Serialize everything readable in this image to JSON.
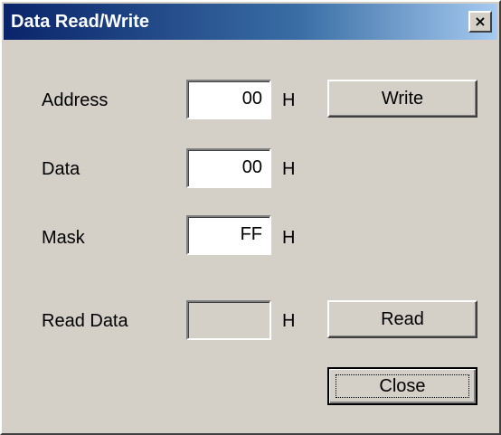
{
  "window": {
    "title": "Data Read/Write",
    "close_glyph": "×"
  },
  "fields": {
    "address": {
      "label": "Address",
      "value": "00",
      "unit": "H"
    },
    "data": {
      "label": "Data",
      "value": "00",
      "unit": "H"
    },
    "mask": {
      "label": "Mask",
      "value": "FF",
      "unit": "H"
    },
    "read_data": {
      "label": "Read Data",
      "value": "",
      "unit": "H"
    }
  },
  "buttons": {
    "write": "Write",
    "read": "Read",
    "close": "Close"
  },
  "colors": {
    "face": "#d4d0c8",
    "title_start": "#0a246a",
    "title_end": "#a6caf0"
  }
}
